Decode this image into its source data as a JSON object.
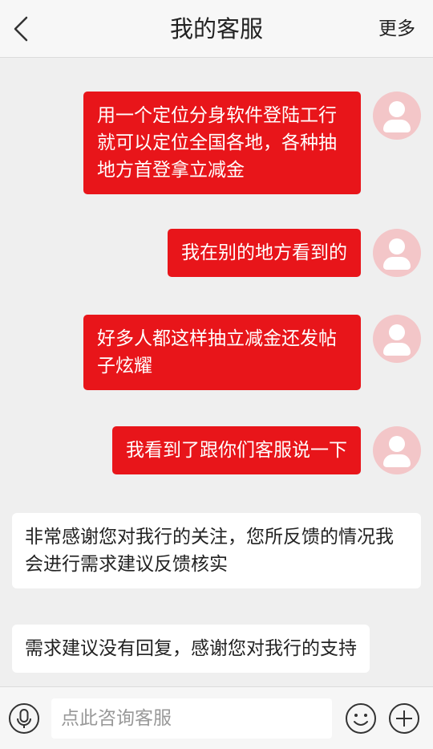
{
  "header": {
    "title": "我的客服",
    "more_label": "更多"
  },
  "messages": {
    "user": [
      {
        "lines": [
          "用一个定位分身软件登陆工行",
          "就可以定位全国各地，各种抽",
          "地方首登拿立减金"
        ]
      },
      {
        "lines": [
          "我在别的地方看到的"
        ]
      },
      {
        "lines": [
          "好多人都这样抽立减金还发帖",
          "子炫耀"
        ]
      },
      {
        "lines": [
          "我看到了跟你们客服说一下"
        ]
      }
    ],
    "service": [
      {
        "lines": [
          "非常感谢您对我行的关注，您所反馈的情况我",
          "会进行需求建议反馈核实"
        ]
      },
      {
        "lines": [
          "需求建议没有回复，感谢您对我行的支持"
        ]
      }
    ]
  },
  "input": {
    "placeholder": "点此咨询客服"
  },
  "colors": {
    "user_bubble": "#e8151a",
    "avatar_bg": "#f3c6c8",
    "background": "#efefef"
  },
  "icons": {
    "back": "back-arrow-icon",
    "voice": "microphone-icon",
    "emoji": "emoji-icon",
    "more_actions": "plus-icon"
  }
}
